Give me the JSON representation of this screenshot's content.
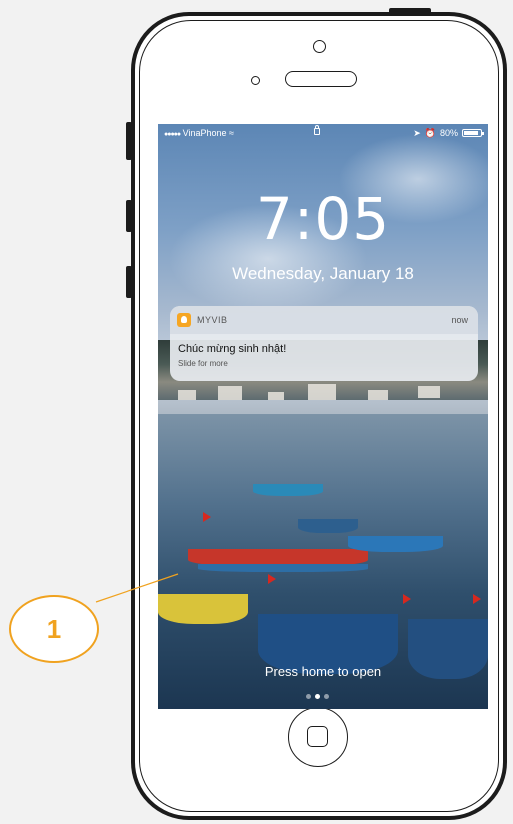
{
  "status_bar": {
    "carrier": "VinaPhone",
    "battery": "80%"
  },
  "lockscreen": {
    "time": "7:05",
    "date": "Wednesday, January 18",
    "press_home": "Press home to open",
    "pages": 3,
    "active_page": 2
  },
  "notification": {
    "app_name": "MYVIB",
    "time": "now",
    "title": "Chúc mừng sinh nhật!",
    "subtitle": "Slide for more"
  },
  "callout": {
    "number": "1"
  },
  "colors": {
    "accent": "#f0a21f",
    "app_icon": "#f6a623"
  }
}
